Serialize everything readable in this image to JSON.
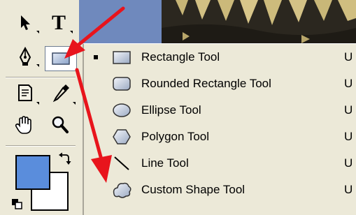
{
  "toolbox": {
    "tools": [
      {
        "name": "move-tool",
        "icon": "arrow-cursor-icon"
      },
      {
        "name": "type-tool",
        "icon": "type-t-icon",
        "glyph": "T"
      },
      {
        "name": "pen-tool",
        "icon": "pen-nib-icon"
      },
      {
        "name": "shape-tool",
        "icon": "rectangle-shape-icon",
        "selected": true
      },
      {
        "name": "notes-tool",
        "icon": "notes-icon"
      },
      {
        "name": "eyedropper-tool",
        "icon": "eyedropper-icon"
      },
      {
        "name": "hand-tool",
        "icon": "hand-icon"
      },
      {
        "name": "zoom-tool",
        "icon": "magnifier-icon"
      }
    ],
    "colors": {
      "foreground": "#5a8ddc",
      "background": "#ffffff"
    }
  },
  "menu": {
    "items": [
      {
        "label": "Rectangle Tool",
        "shortcut": "U",
        "icon": "rectangle-icon",
        "checked": true
      },
      {
        "label": "Rounded Rectangle Tool",
        "shortcut": "U",
        "icon": "rounded-rectangle-icon",
        "checked": false
      },
      {
        "label": "Ellipse Tool",
        "shortcut": "U",
        "icon": "ellipse-icon",
        "checked": false
      },
      {
        "label": "Polygon Tool",
        "shortcut": "U",
        "icon": "polygon-icon",
        "checked": false
      },
      {
        "label": "Line Tool",
        "shortcut": "U",
        "icon": "line-icon",
        "checked": false
      },
      {
        "label": "Custom Shape Tool",
        "shortcut": "U",
        "icon": "custom-shape-icon",
        "checked": false
      }
    ]
  },
  "annotation": {
    "arrow_color": "#e8141c"
  }
}
